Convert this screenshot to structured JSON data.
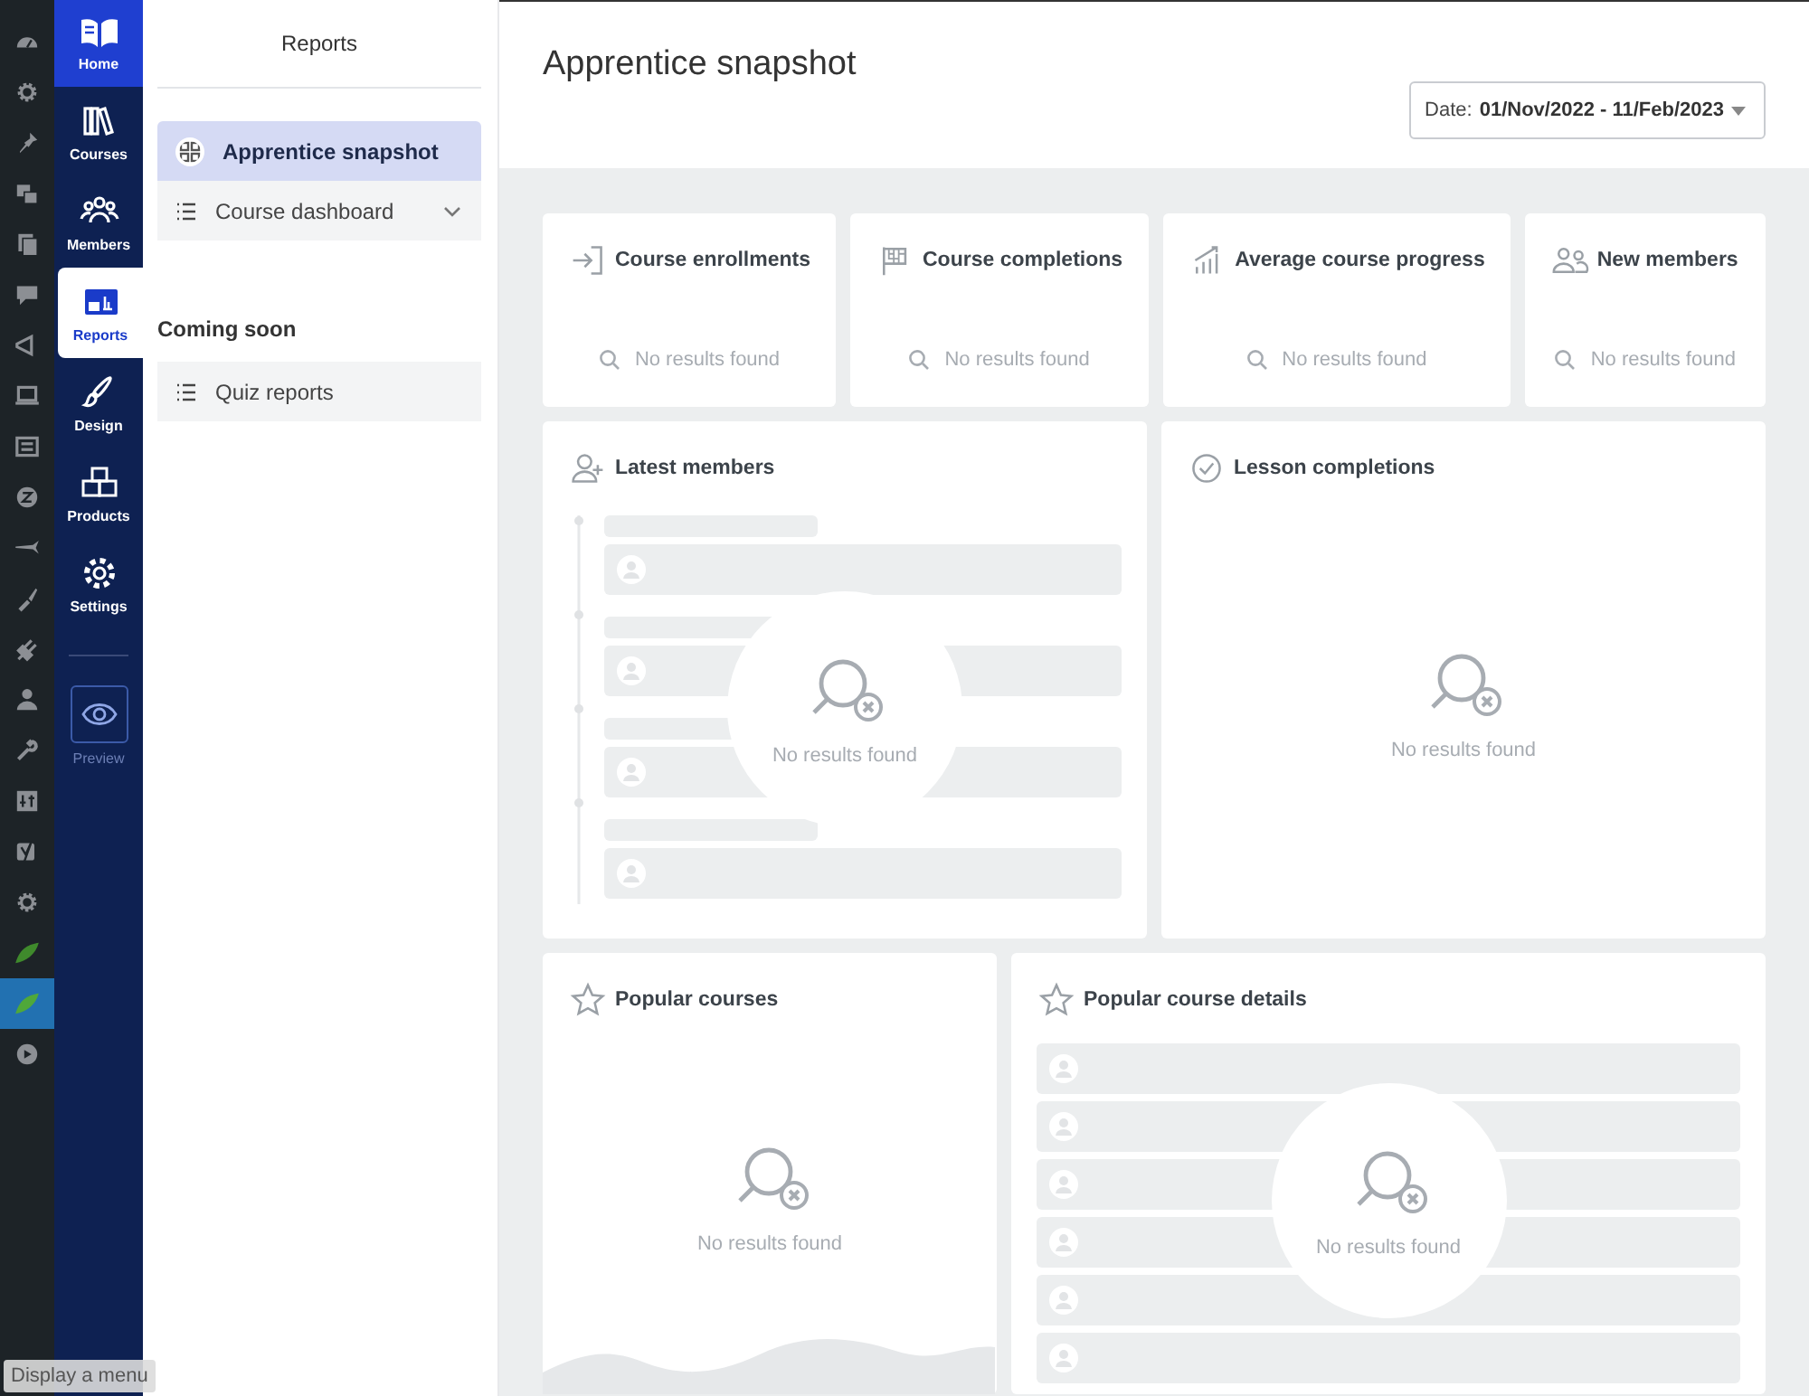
{
  "admin_menu": [
    {
      "selected": false
    },
    {
      "selected": false
    },
    {
      "selected": false
    },
    {
      "selected": false
    },
    {
      "selected": false
    },
    {
      "selected": false
    },
    {
      "selected": false
    },
    {
      "selected": false
    },
    {
      "selected": false
    },
    {
      "selected": false
    },
    {
      "selected": false
    },
    {
      "selected": false
    },
    {
      "selected": false
    },
    {
      "selected": false
    },
    {
      "selected": false
    },
    {
      "selected": false
    },
    {
      "selected": false
    },
    {
      "selected": false
    },
    {
      "selected": false
    },
    {
      "selected": true
    },
    {
      "selected": false
    }
  ],
  "tooltip": "Display a menu",
  "nav": {
    "home": "Home",
    "items": [
      {
        "label": "Courses",
        "selected": false
      },
      {
        "label": "Members",
        "selected": false
      },
      {
        "label": "Reports",
        "selected": true
      },
      {
        "label": "Design",
        "selected": false
      },
      {
        "label": "Products",
        "selected": false
      },
      {
        "label": "Settings",
        "selected": false
      }
    ],
    "preview": "Preview"
  },
  "submenu": {
    "title": "Reports",
    "items": [
      {
        "label": "Apprentice snapshot",
        "selected": true,
        "kind": "grid"
      },
      {
        "label": "Course dashboard",
        "selected": false,
        "kind": "list",
        "expanded": false
      }
    ],
    "section": "Coming soon",
    "soon_items": [
      {
        "label": "Quiz reports",
        "selected": false,
        "kind": "list"
      }
    ]
  },
  "page": {
    "title": "Apprentice snapshot",
    "date_filter": {
      "label": "Date:",
      "value": "01/Nov/2022 - 11/Feb/2023"
    }
  },
  "stat_cards": [
    {
      "title": "Course enrollments",
      "empty": "No results found"
    },
    {
      "title": "Course completions",
      "empty": "No results found"
    },
    {
      "title": "Average course progress",
      "empty": "No results found"
    },
    {
      "title": "New members",
      "empty": "No results found"
    }
  ],
  "panels": [
    {
      "title": "Latest members",
      "kind": "timeline",
      "empty": "No results found"
    },
    {
      "title": "Lesson completions",
      "kind": "plain",
      "empty": "No results found"
    },
    {
      "title": "Popular courses",
      "kind": "area",
      "empty": "No results found"
    },
    {
      "title": "Popular course details",
      "kind": "rows",
      "empty": "No results found"
    }
  ]
}
